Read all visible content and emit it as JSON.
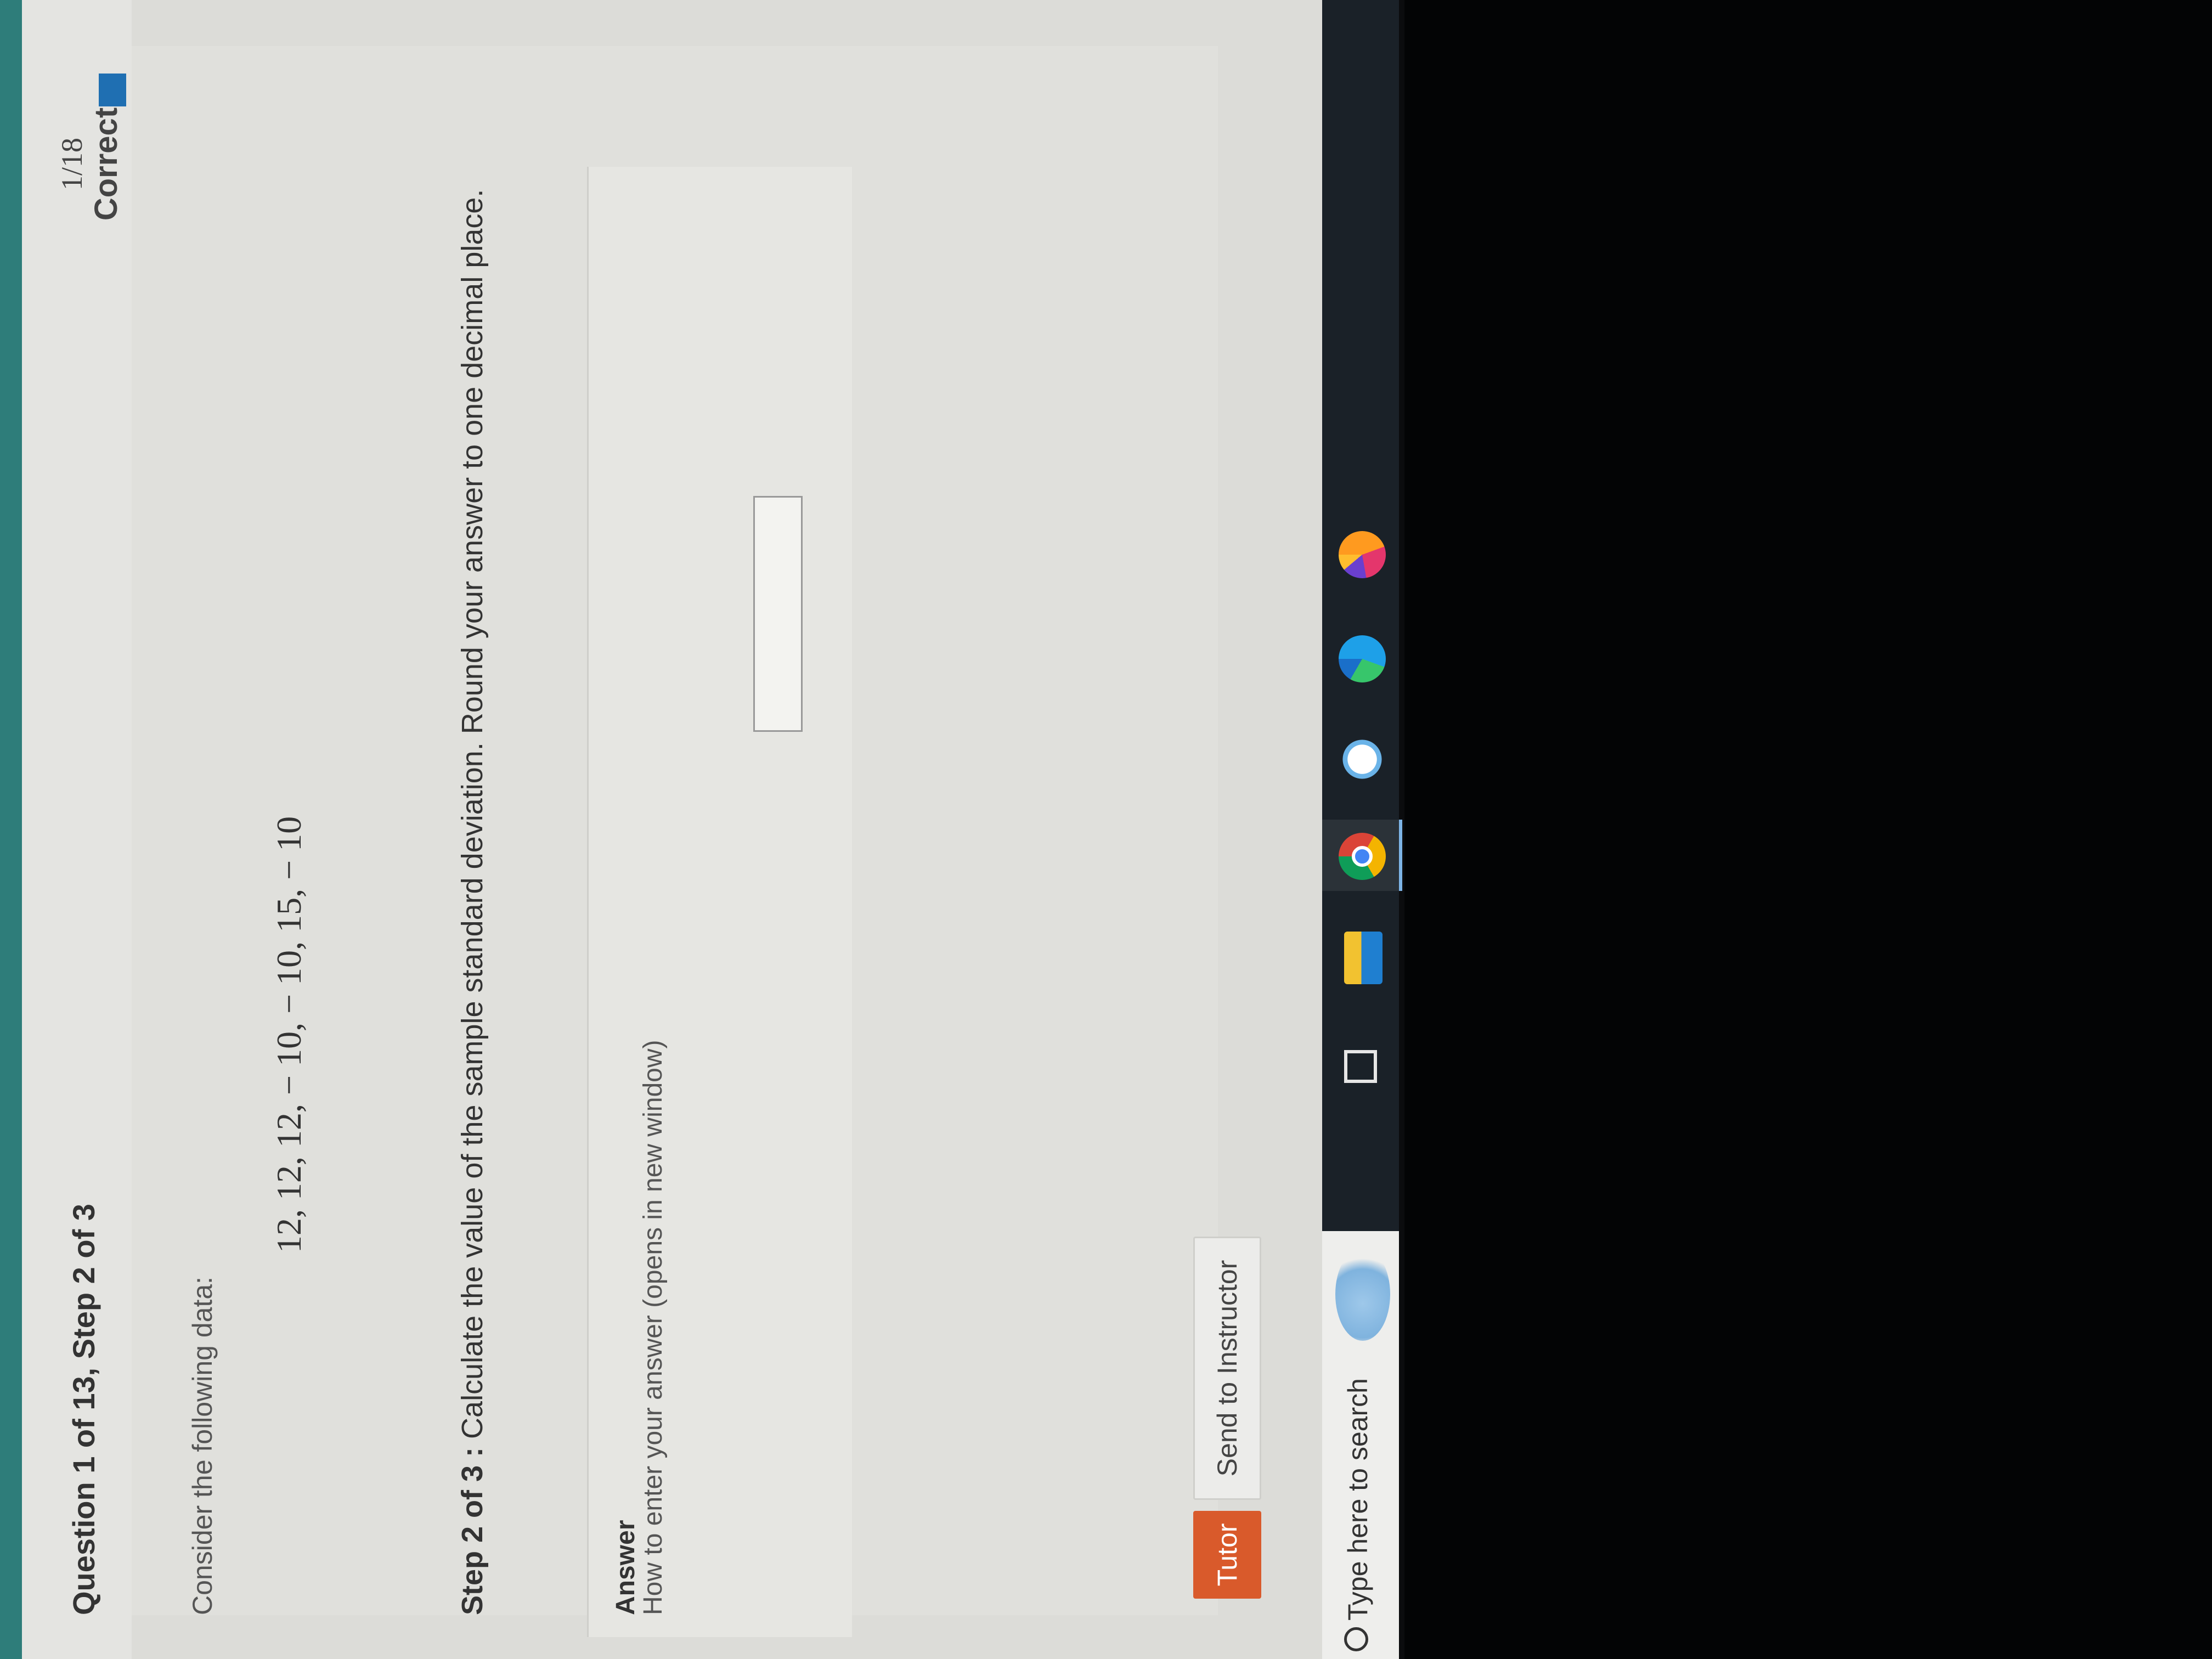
{
  "question": {
    "title": "Question 1 of 13,  Step 2 of 3",
    "score": "1/18",
    "status": "Correct",
    "flag_color": "#1f6fb2"
  },
  "problem": {
    "intro": "Consider the following data:",
    "data_values": "12, 12, 12, − 10, − 10, 15, − 10",
    "step_label": "Step 2 of 3 :",
    "step_text": " Calculate the value of the sample standard deviation. Round your answer to one decimal place."
  },
  "answer": {
    "label": "Answer",
    "help_link": "How to enter your answer (opens in new window)",
    "input_value": ""
  },
  "buttons": {
    "tutor": "Tutor",
    "send_to_instructor": "Send to Instructor",
    "tutor_color": "#d95a2b"
  },
  "taskbar": {
    "search_placeholder": "Type here to search",
    "icons": [
      "weather-icon",
      "task-view-icon",
      "file-explorer-icon",
      "chrome-icon",
      "snipping-tool-icon",
      "edge-icon",
      "firefox-icon"
    ]
  }
}
